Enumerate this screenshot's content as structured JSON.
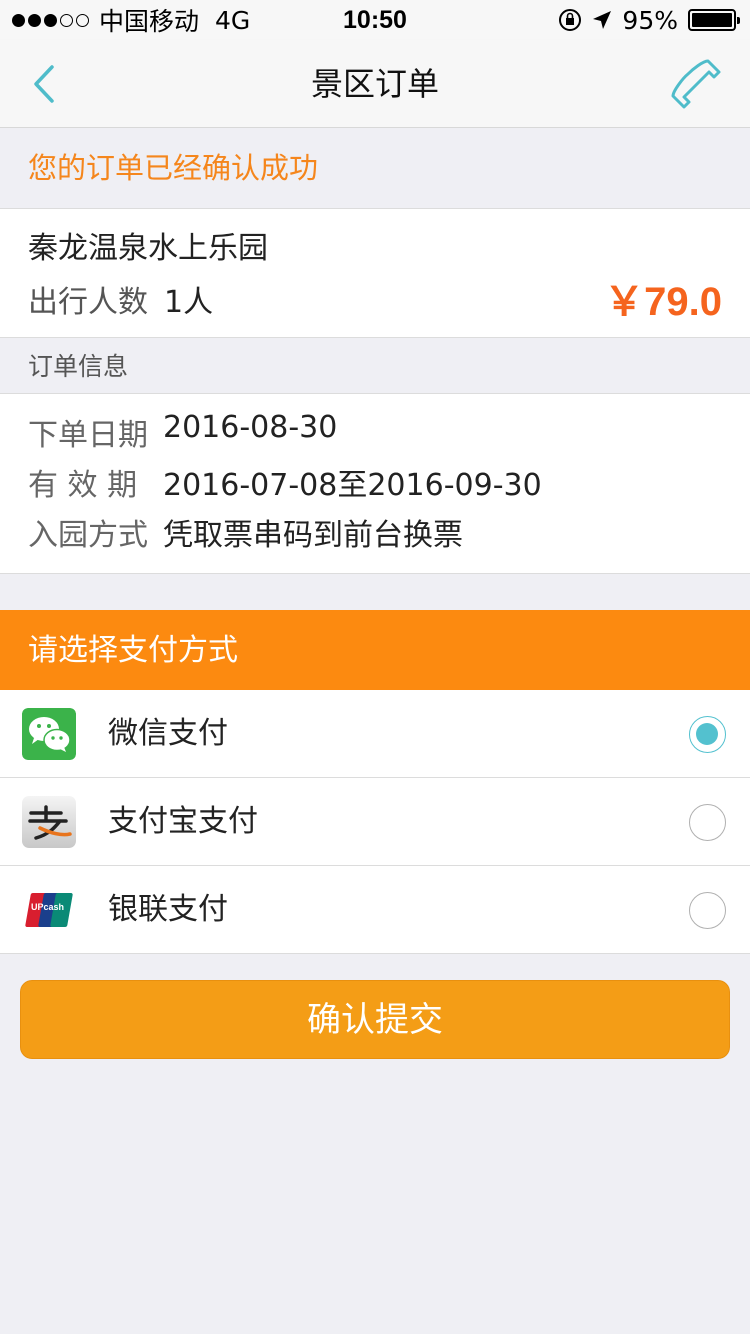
{
  "status_bar": {
    "carrier": "中国移动",
    "network": "4G",
    "time": "10:50",
    "battery": "95%"
  },
  "nav": {
    "title": "景区订单",
    "back_icon": "chevron-left-icon",
    "phone_icon": "phone-icon"
  },
  "order": {
    "confirm_message": "您的订单已经确认成功",
    "park_name": "秦龙温泉水上乐园",
    "travelers_label": "出行人数",
    "travelers_value": "1人",
    "price": "￥79.0"
  },
  "info": {
    "section_title": "订单信息",
    "rows": [
      {
        "label": "下单日期",
        "value": "2016-08-30"
      },
      {
        "label": "有 效 期",
        "value": "2016-07-08至2016-09-30"
      },
      {
        "label": "入园方式",
        "value": "凭取票串码到前台换票"
      }
    ]
  },
  "payment": {
    "header": "请选择支付方式",
    "methods": [
      {
        "label": "微信支付",
        "icon": "wechat-pay-icon",
        "selected": true
      },
      {
        "label": "支付宝支付",
        "icon": "alipay-icon",
        "selected": false
      },
      {
        "label": "银联支付",
        "icon": "unionpay-icon",
        "selected": false
      }
    ]
  },
  "submit_label": "确认提交",
  "colors": {
    "accent_orange": "#fc8a10",
    "price_orange": "#f5641e",
    "teal": "#53c1cf",
    "button": "#f49d16"
  }
}
